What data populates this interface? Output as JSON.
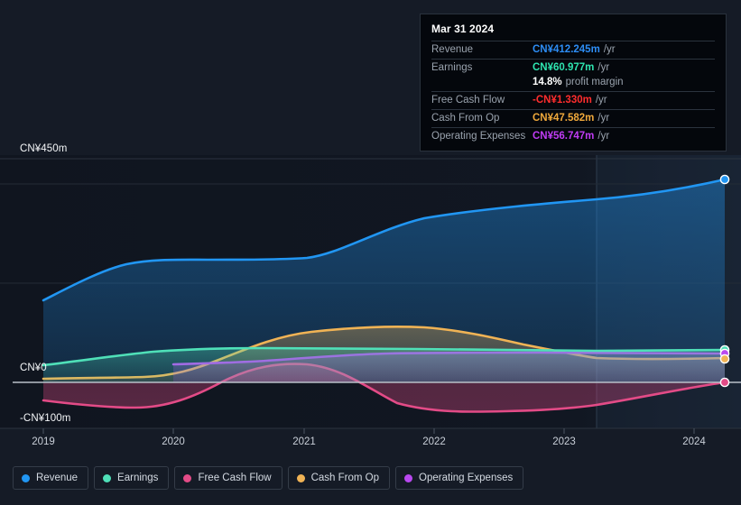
{
  "tooltip": {
    "date": "Mar 31 2024",
    "rows": [
      {
        "key": "Revenue",
        "value": "CN¥412.245m",
        "unit": "/yr",
        "color": "#2d8df5"
      },
      {
        "key": "Earnings",
        "value": "CN¥60.977m",
        "unit": "/yr",
        "color": "#2ee6b0"
      },
      {
        "key": "",
        "value": "14.8%",
        "unit": "profit margin",
        "color": "#ffffff"
      },
      {
        "key": "Free Cash Flow",
        "value": "-CN¥1.330m",
        "unit": "/yr",
        "color": "#ff2d2d"
      },
      {
        "key": "Cash From Op",
        "value": "CN¥47.582m",
        "unit": "/yr",
        "color": "#f0a93b"
      },
      {
        "key": "Operating Expenses",
        "value": "CN¥56.747m",
        "unit": "/yr",
        "color": "#c13cf5"
      }
    ]
  },
  "legend": [
    {
      "label": "Revenue",
      "color": "#2196f3"
    },
    {
      "label": "Earnings",
      "color": "#4fe0b8"
    },
    {
      "label": "Free Cash Flow",
      "color": "#e34b87"
    },
    {
      "label": "Cash From Op",
      "color": "#f0b355"
    },
    {
      "label": "Operating Expenses",
      "color": "#b948f0"
    }
  ],
  "axis": {
    "y_top": "CN¥450m",
    "y_zero": "CN¥0",
    "y_bottom": "-CN¥100m",
    "x_ticks": [
      "2019",
      "2020",
      "2021",
      "2022",
      "2023",
      "2024"
    ]
  },
  "chart_data": {
    "type": "area",
    "title": "",
    "xlabel": "",
    "ylabel": "CN¥",
    "currency": "CN¥",
    "unit": "m",
    "ylim": [
      -100,
      450
    ],
    "y_ticks": [
      450,
      0,
      -100
    ],
    "grid": true,
    "legend_position": "bottom",
    "x": [
      "2019",
      "2020",
      "2021",
      "2022",
      "2023",
      "2024"
    ],
    "x_range": [
      "2018-12-31",
      "2024-03-31"
    ],
    "forecast_divider_x": "2023-04-01",
    "series": [
      {
        "name": "Revenue",
        "color": "#2196f3",
        "values": [
          168,
          248,
          258,
          305,
          352,
          412.245
        ],
        "end_value": 412.245,
        "end_label": "CN¥412.245m"
      },
      {
        "name": "Earnings",
        "color": "#4fe0b8",
        "values": [
          33,
          48,
          52,
          55,
          57,
          60.977
        ],
        "end_value": 60.977,
        "end_label": "CN¥60.977m"
      },
      {
        "name": "Free Cash Flow",
        "color": "#e34b87",
        "values": [
          -36,
          -42,
          -1,
          -57,
          -62,
          -1.33
        ],
        "end_value": -1.33,
        "end_label": "-CN¥1.330m"
      },
      {
        "name": "Cash From Op",
        "color": "#f0b355",
        "values": [
          8,
          9,
          62,
          113,
          55,
          47.582
        ],
        "end_value": 47.582,
        "end_label": "CN¥47.582m"
      },
      {
        "name": "Operating Expenses",
        "color": "#b948f0",
        "values": [
          null,
          36,
          45,
          53,
          54,
          56.747
        ],
        "end_value": 56.747,
        "end_label": "CN¥56.747m"
      }
    ]
  },
  "colors": {
    "background": "#151b26",
    "plot_background": "#10151f",
    "zero_line": "#b9c0c9",
    "grid": "#252c38",
    "tooltip_background": "#04070c"
  }
}
